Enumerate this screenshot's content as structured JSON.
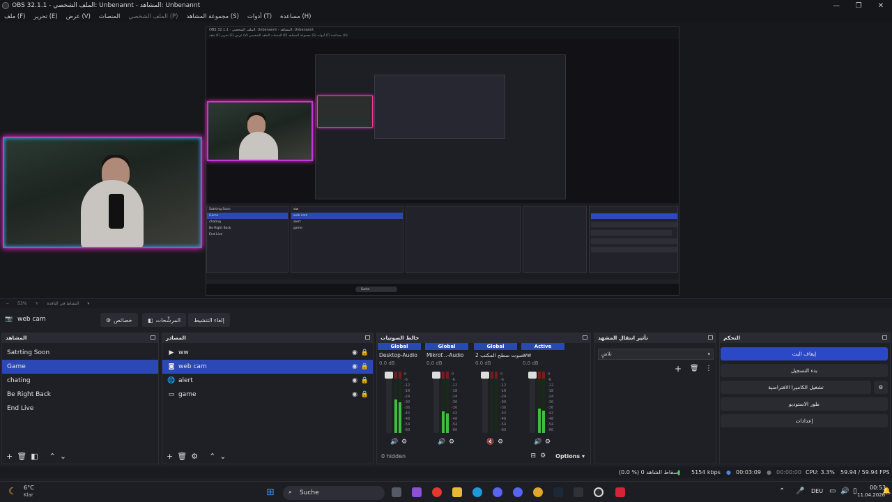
{
  "window": {
    "title": "OBS 32.1.1 - الملف الشخصي: Unbenannt - المشاهد: Unbenannt",
    "minimize": "—",
    "maximize": "❐",
    "close": "✕"
  },
  "menu": [
    {
      "label": "ملف (F)",
      "enabled": true
    },
    {
      "label": "تحرير (E)",
      "enabled": true
    },
    {
      "label": "عرض (V)",
      "enabled": true
    },
    {
      "label": "المنصات",
      "enabled": true
    },
    {
      "label": "الملف الشخصي (P)",
      "enabled": false
    },
    {
      "label": "مجموعة المشاهد (S)",
      "enabled": true
    },
    {
      "label": "أدوات (T)",
      "enabled": true
    },
    {
      "label": "مساعدة (H)",
      "enabled": true
    }
  ],
  "zoombar": {
    "zoom": "53%",
    "label": "النشاط في النافذة"
  },
  "source_toolbar": {
    "selected_source": "web cam",
    "properties": "خصائص",
    "filters": "المرشِّحات",
    "deactivate": "إلغاء التنشيط"
  },
  "scenes": {
    "title": "المشاهد",
    "items": [
      "Satrting Soon",
      "Game",
      "chating",
      "Be Right Back",
      "End Live"
    ],
    "selected": 1
  },
  "sources": {
    "title": "المصادر",
    "items": [
      {
        "name": "ww",
        "icon": "play-icon"
      },
      {
        "name": "web cam",
        "icon": "camera-icon"
      },
      {
        "name": "alert",
        "icon": "globe-icon"
      },
      {
        "name": "game",
        "icon": "monitor-icon"
      }
    ],
    "selected": 1
  },
  "mixer": {
    "title": "خالط الصوتيات",
    "tick_labels": [
      "0",
      "-6",
      "-12",
      "-18",
      "-24",
      "-30",
      "-36",
      "-42",
      "-48",
      "-54",
      "-60"
    ],
    "channels": [
      {
        "scope": "Global",
        "name": "Desktop-Audio",
        "db": "0.0 dB",
        "level": 0.55,
        "muted": false
      },
      {
        "scope": "Global",
        "name": "Mikrof...-Audio",
        "db": "0.0 dB",
        "level": 0.35,
        "muted": false
      },
      {
        "scope": "Global",
        "name": "صوت سطح المكتب 2",
        "db": "0.0 dB",
        "level": 0.0,
        "muted": true
      },
      {
        "scope": "Active",
        "name": "ww",
        "db": "0.0 dB",
        "level": 0.4,
        "muted": false
      }
    ],
    "hidden": "0 hidden",
    "options": "Options"
  },
  "transitions": {
    "title": "تأثير انتقال المشهد",
    "selected": "تلاشٍ"
  },
  "controls": {
    "title": "التحكم",
    "buttons": [
      {
        "label": "إيقاف البث",
        "primary": true
      },
      {
        "label": "بدء التسجيل",
        "primary": false
      },
      {
        "label": "تشغيل الكاميرا الافتراضية",
        "primary": false
      },
      {
        "label": "طور الاستوديو",
        "primary": false
      },
      {
        "label": "إعدادات",
        "primary": false
      }
    ]
  },
  "status": {
    "dropped": "(0.0 %) إسقاط الشاهد 0",
    "bitrate": "5154 kbps",
    "stream_time": "00:03:09",
    "rec_time": "00:00:00",
    "cpu": "CPU: 3.3%",
    "fps": "59.94 / 59.94 FPS"
  },
  "taskbar": {
    "weather_temp": "6°C",
    "weather_desc": "Klar",
    "search": "Suche",
    "lang": "DEU",
    "time": "00:53",
    "date": "11.04.2026"
  },
  "capture": {
    "title": "OBS 32.1.1 - الملف الشخصي: Unbenannt - المشاهد: Unbenannt",
    "menu": "ملف (F)   تحرير (E)   عرض (V)   المنصات   الملف الشخصي (P)   مجموعة المشاهد (S)   أدوات (T)   مساعدة (H)",
    "source": "web cam",
    "scenes": [
      "Satrting Soon",
      "Game",
      "chating",
      "Be Right Back",
      "End Live"
    ],
    "sources": [
      "ww",
      "web cam",
      "alert",
      "game"
    ],
    "search": "Suche"
  }
}
